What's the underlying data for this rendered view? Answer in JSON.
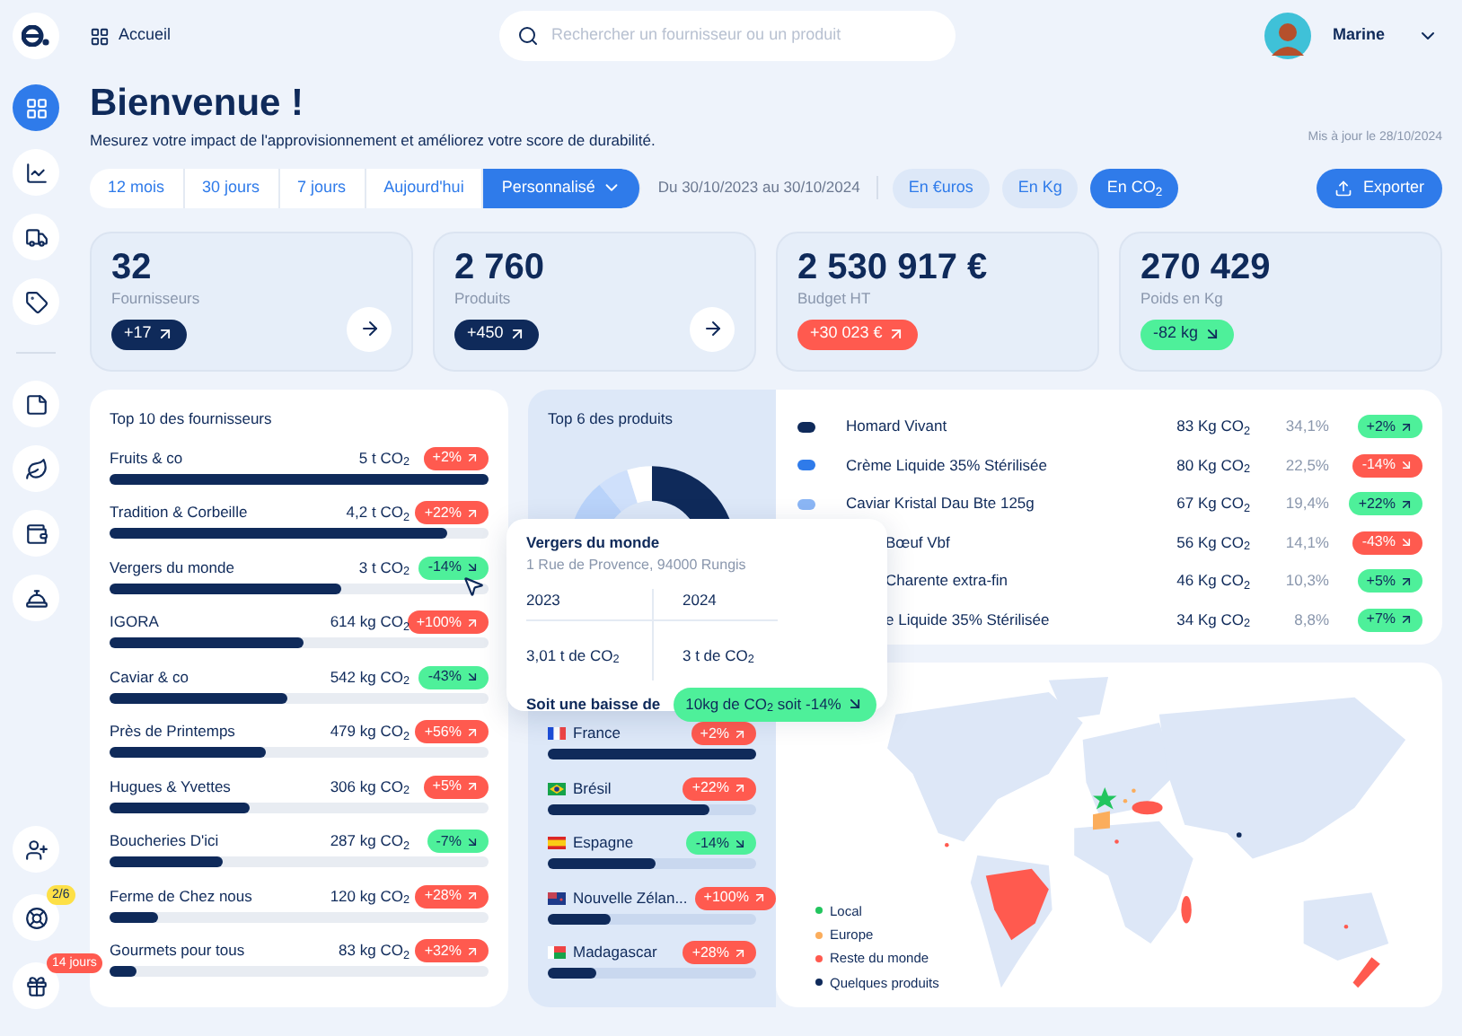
{
  "sidebar": {
    "items": [
      {
        "selected": true
      },
      {
        "selected": false
      },
      {
        "selected": false
      },
      {
        "selected": false
      },
      {
        "selected": false
      },
      {
        "selected": false
      },
      {
        "selected": false
      },
      {
        "selected": false
      }
    ],
    "badges": [
      {
        "text": "2/6",
        "color": "#fde047"
      },
      {
        "text": "14 jours",
        "color": "#ff5a4f"
      }
    ]
  },
  "breadcrumb": "Accueil",
  "search": {
    "placeholder": "Rechercher un fournisseur ou un produit"
  },
  "user": {
    "name": "Marine"
  },
  "title": "Bienvenue !",
  "subtitle": "Mesurez votre impact de l'approvisionnement et améliorez votre score de durabilité.",
  "updated": "Mis à jour le 28/10/2024",
  "periods": [
    {
      "label": "12 mois",
      "selected": false
    },
    {
      "label": "30 jours",
      "selected": false
    },
    {
      "label": "7 jours",
      "selected": false
    },
    {
      "label": "Aujourd'hui",
      "selected": false
    },
    {
      "label": "Personnalisé",
      "selected": true
    }
  ],
  "date_range": "Du 30/10/2023 au 30/10/2024",
  "units": [
    {
      "label": "En €uros",
      "selected": false
    },
    {
      "label": "En Kg",
      "selected": false
    },
    {
      "label": "En CO$_{2}$",
      "selected": true
    }
  ],
  "export": "Exporter",
  "kpis": [
    {
      "value": "32",
      "label": "Fournisseurs",
      "delta": "+17",
      "rising": true,
      "color": "#0f2a5a",
      "link": true
    },
    {
      "value": "2 760",
      "label": "Produits",
      "delta": "+450",
      "rising": true,
      "color": "#0f2a5a",
      "link": true
    },
    {
      "value": "2 530 917 €",
      "label": "Budget HT",
      "delta": "+30 023 €",
      "rising": true,
      "color": "#ff5a4f",
      "link": false
    },
    {
      "value": "270 429",
      "label": "Poids en Kg",
      "delta": "-82 kg",
      "rising": false,
      "color": "#4ef09a",
      "link": false
    }
  ],
  "suppliers": {
    "title": "Top 10 des fournisseurs",
    "rows": [
      {
        "name": "Fruits & co",
        "value": "5 t CO$_{2}$",
        "delta": "+2%",
        "rising": true,
        "color": "#ff5a4f",
        "level": 1.0
      },
      {
        "name": "Tradition & Corbeille",
        "value": "4,2 t CO$_{2}$",
        "delta": "+22%",
        "rising": true,
        "color": "#ff5a4f",
        "level": 0.89
      },
      {
        "name": "Vergers du monde",
        "value": "3 t CO$_{2}$",
        "delta": "-14%",
        "rising": false,
        "color": "#4ef09a",
        "level": 0.61
      },
      {
        "name": "IGORA",
        "value": "614 kg CO$_{2}$",
        "delta": "+100%",
        "rising": true,
        "color": "#ff5a4f",
        "level": 0.51
      },
      {
        "name": "Caviar & co",
        "value": "542 kg CO$_{2}$",
        "delta": "-43%",
        "rising": false,
        "color": "#4ef09a",
        "level": 0.47
      },
      {
        "name": "Près de Printemps",
        "value": "479 kg CO$_{2}$",
        "delta": "+56%",
        "rising": true,
        "color": "#ff5a4f",
        "level": 0.41
      },
      {
        "name": "Hugues & Yvettes",
        "value": "306 kg CO$_{2}$",
        "delta": "+5%",
        "rising": true,
        "color": "#ff5a4f",
        "level": 0.37
      },
      {
        "name": "Boucheries D'ici",
        "value": "287 kg CO$_{2}$",
        "delta": "-7%",
        "rising": false,
        "color": "#4ef09a",
        "level": 0.3
      },
      {
        "name": "Ferme de Chez nous",
        "value": "120 kg CO$_{2}$",
        "delta": "+28%",
        "rising": true,
        "color": "#ff5a4f",
        "level": 0.13
      },
      {
        "name": "Gourmets pour tous",
        "value": "83 kg CO$_{2}$",
        "delta": "+32%",
        "rising": true,
        "color": "#ff5a4f",
        "level": 0.07
      }
    ]
  },
  "products": {
    "title": "Top 6 des produits",
    "rows": [
      {
        "color": "#0f2a5a",
        "name": "Homard Vivant",
        "value": "83 Kg CO$_{2}$",
        "share": "34,1%",
        "delta": "+2%",
        "rising": true,
        "good": true
      },
      {
        "color": "#2f7bea",
        "name": "Crème Liquide 35% Stérilisée",
        "value": "80 Kg CO$_{2}$",
        "share": "22,5%",
        "delta": "-14%",
        "rising": false,
        "good": false
      },
      {
        "color": "#8bb6f5",
        "name": "Caviar Kristal Dau Bte 125g",
        "value": "67 Kg CO$_{2}$",
        "share": "19,4%",
        "delta": "+22%",
        "rising": true,
        "good": true
      },
      {
        "name": "Bœuf Vbf",
        "value": "56 Kg CO$_{2}$",
        "share": "14,1%",
        "delta": "-43%",
        "rising": false,
        "good": false
      },
      {
        "name": "Charente extra-fin",
        "value": "46 Kg CO$_{2}$",
        "share": "10,3%",
        "delta": "+5%",
        "rising": true,
        "good": true
      },
      {
        "name": "e Liquide 35% Stérilisée",
        "value": "34 Kg CO$_{2}$",
        "share": "8,8%",
        "delta": "+7%",
        "rising": true,
        "good": true
      }
    ]
  },
  "countries": [
    {
      "name": "France",
      "delta": "+2%",
      "rising": true,
      "color": "#ff5a4f",
      "level": 1.0
    },
    {
      "name": "Brésil",
      "delta": "+22%",
      "rising": true,
      "color": "#ff5a4f",
      "level": 0.78
    },
    {
      "name": "Espagne",
      "delta": "-14%",
      "rising": false,
      "color": "#4ef09a",
      "level": 0.52
    },
    {
      "name": "Nouvelle Zélan...",
      "delta": "+100%",
      "rising": true,
      "color": "#ff5a4f",
      "level": 0.3
    },
    {
      "name": "Madagascar",
      "delta": "+28%",
      "rising": true,
      "color": "#ff5a4f",
      "level": 0.23
    }
  ],
  "legend": [
    {
      "label": "Local",
      "color": "#22c55e"
    },
    {
      "label": "Europe",
      "color": "#fbad5c"
    },
    {
      "label": "Reste du monde",
      "color": "#ff5a4f"
    },
    {
      "label": "Quelques produits",
      "color": "#0f2a5a"
    }
  ],
  "tooltip": {
    "title": "Vergers du monde",
    "address": "1 Rue de Provence, 94000 Rungis",
    "columns": [
      "2023",
      "2024"
    ],
    "values": [
      "3,01 t de CO$_{2}$",
      "3 t de CO$_{2}$"
    ],
    "summary": "Soit une baisse de",
    "result": "10kg de CO$_{2}$ soit -14%",
    "rising": false
  }
}
